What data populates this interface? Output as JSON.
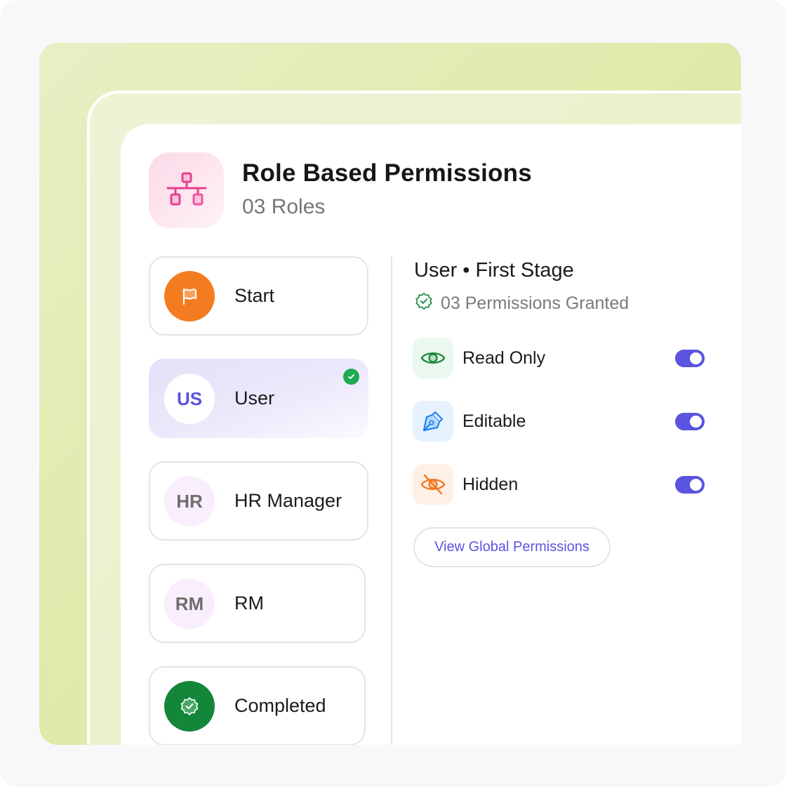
{
  "header": {
    "icon": "hierarchy-icon",
    "title": "Role Based Permissions",
    "subtitle": "03 Roles"
  },
  "roles": [
    {
      "label": "Start",
      "avatar_text": "",
      "avatar_icon": "flag-icon",
      "avatar_bg": "#f47c20",
      "active": false
    },
    {
      "label": "User",
      "avatar_text": "US",
      "avatar_color": "#5b54e0",
      "avatar_bg": "#ffffff",
      "active": true,
      "badge": "check-icon"
    },
    {
      "label": "HR Manager",
      "avatar_text": "HR",
      "avatar_color": "#6e6e6e",
      "avatar_bg": "#f8eefc",
      "active": false
    },
    {
      "label": "RM",
      "avatar_text": "RM",
      "avatar_color": "#6e6e6e",
      "avatar_bg": "#f8eefc",
      "active": false
    },
    {
      "label": "Completed",
      "avatar_text": "",
      "avatar_icon": "verified-badge-icon",
      "avatar_bg": "#138639",
      "active": false
    }
  ],
  "detail": {
    "stage_title": "User • First Stage",
    "granted_icon": "verified-badge-icon",
    "granted_text": "03 Permissions Granted",
    "permissions": [
      {
        "label": "Read Only",
        "icon": "eye-icon",
        "icon_bg": "#eaf8ee",
        "icon_color": "#1f8a3e",
        "enabled": true
      },
      {
        "label": "Editable",
        "icon": "pen-nib-icon",
        "icon_bg": "#e6f2fe",
        "icon_color": "#1e84f0",
        "enabled": true
      },
      {
        "label": "Hidden",
        "icon": "eye-off-icon",
        "icon_bg": "#fff0e6",
        "icon_color": "#f07a22",
        "enabled": true
      }
    ],
    "global_button": "View Global Permissions"
  },
  "colors": {
    "accent": "#5b54e0",
    "brand_pink": "#e83e8c",
    "success": "#1eaa4f"
  }
}
